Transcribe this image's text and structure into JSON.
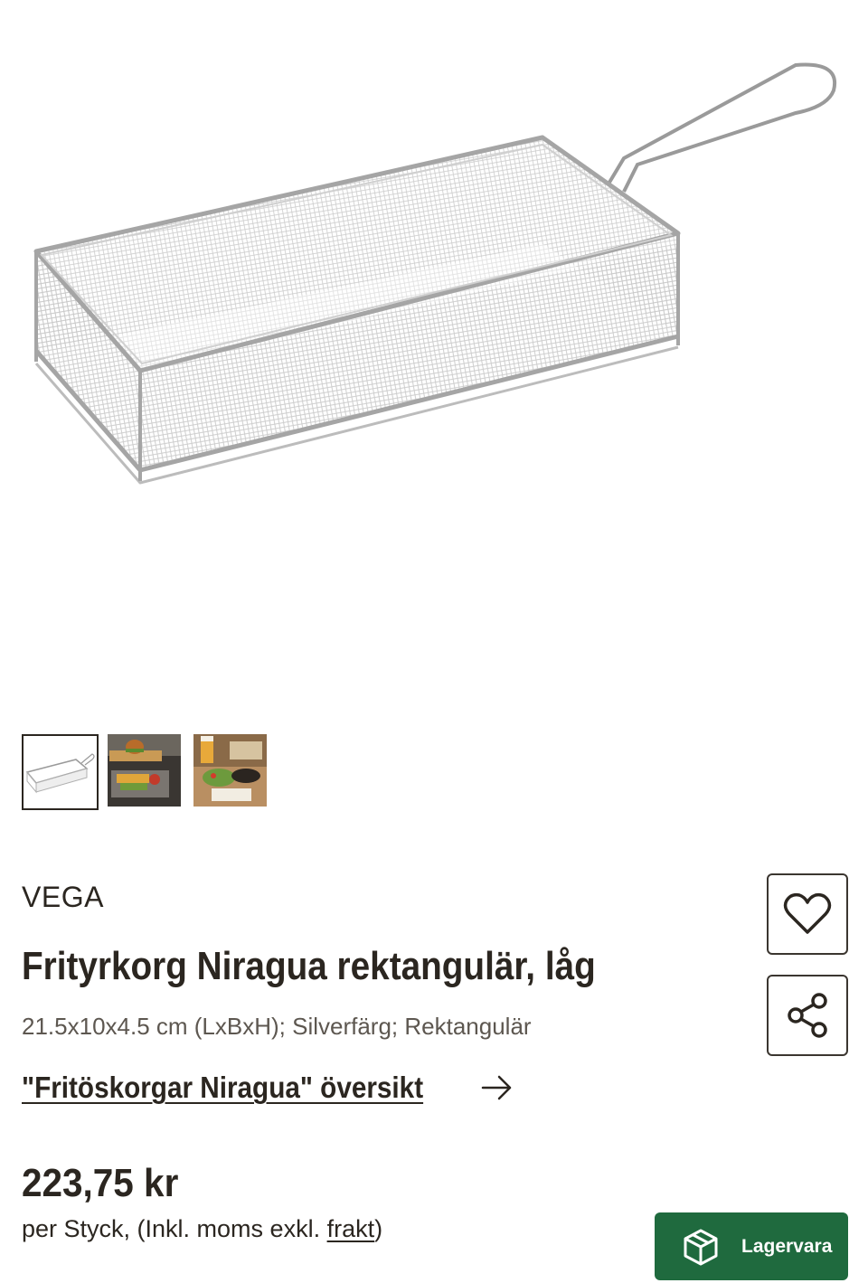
{
  "product": {
    "image_alt": "Frityrkorg Niragua rektangulär, låg",
    "brand": "VEGA",
    "title": "Frityrkorg Niragua rektangulär, låg",
    "specs": "21.5x10x4.5 cm (LxBxH); Silverfärg; Rektangulär",
    "overview_link": "\"Fritöskorgar Niragua\" översikt",
    "price": "223,75 kr",
    "price_note_prefix": "per Styck, (Inkl. moms exkl. ",
    "price_note_link": "frakt",
    "price_note_suffix": ")",
    "stock_label": "Lagervara"
  },
  "thumbnails": [
    {
      "name": "wire-basket",
      "active": true
    },
    {
      "name": "burger-fries-serving",
      "active": false
    },
    {
      "name": "beer-salad-serving",
      "active": false
    }
  ],
  "icons": {
    "favorite": "heart-icon",
    "share": "share-icon",
    "overview_arrow": "arrow-right-icon",
    "stock": "package-icon"
  },
  "colors": {
    "text": "#2b2620",
    "muted": "#5d5750",
    "accent_green": "#1f6a3e"
  }
}
